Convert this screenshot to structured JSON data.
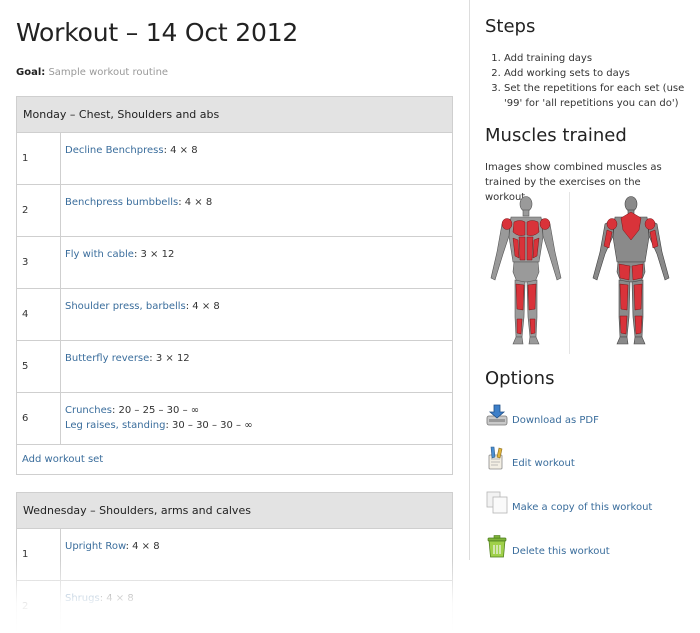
{
  "page": {
    "title": "Workout – 14 Oct 2012",
    "goal_label": "Goal:",
    "goal_value": "Sample workout routine"
  },
  "days": [
    {
      "header": "Monday – Chest, Shoulders and abs",
      "sets": [
        {
          "num": "1",
          "exercises": [
            {
              "name": "Decline Benchpress",
              "reps": ": 4 × 8"
            }
          ]
        },
        {
          "num": "2",
          "exercises": [
            {
              "name": "Benchpress bumbbells",
              "reps": ": 4 × 8"
            }
          ]
        },
        {
          "num": "3",
          "exercises": [
            {
              "name": "Fly with cable",
              "reps": ": 3 × 12"
            }
          ]
        },
        {
          "num": "4",
          "exercises": [
            {
              "name": "Shoulder press, barbells",
              "reps": ": 4 × 8"
            }
          ]
        },
        {
          "num": "5",
          "exercises": [
            {
              "name": "Butterfly reverse",
              "reps": ": 3 × 12"
            }
          ]
        },
        {
          "num": "6",
          "exercises": [
            {
              "name": "Crunches",
              "reps": ": 20 – 25 – 30 – ∞"
            },
            {
              "name": "Leg raises, standing",
              "reps": ": 30 – 30 – 30 – ∞"
            }
          ]
        }
      ],
      "add_label": "Add workout set"
    },
    {
      "header": "Wednesday – Shoulders, arms and calves",
      "sets": [
        {
          "num": "1",
          "exercises": [
            {
              "name": "Upright Row",
              "reps": ": 4 × 8"
            }
          ]
        },
        {
          "num": "2",
          "exercises": [
            {
              "name": "Shrugs",
              "reps": ": 4 × 8"
            }
          ]
        }
      ]
    }
  ],
  "sidebar": {
    "steps_title": "Steps",
    "steps": [
      "Add training days",
      "Add working sets to days",
      "Set the repetitions for each set (use '99' for 'all repetitions you can do')"
    ],
    "muscles_title": "Muscles trained",
    "muscles_text": "Images show combined muscles as trained by the exercises on the workout.",
    "options_title": "Options",
    "options": [
      {
        "label": "Download as PDF",
        "icon": "download-pdf-icon"
      },
      {
        "label": "Edit workout",
        "icon": "edit-icon"
      },
      {
        "label": "Make a copy of this workout",
        "icon": "copy-icon"
      },
      {
        "label": "Delete this workout",
        "icon": "delete-icon"
      }
    ]
  },
  "colors": {
    "link": "#3a6d9c",
    "muscle_highlight": "#d9333a",
    "header_bg": "#e3e3e3"
  }
}
